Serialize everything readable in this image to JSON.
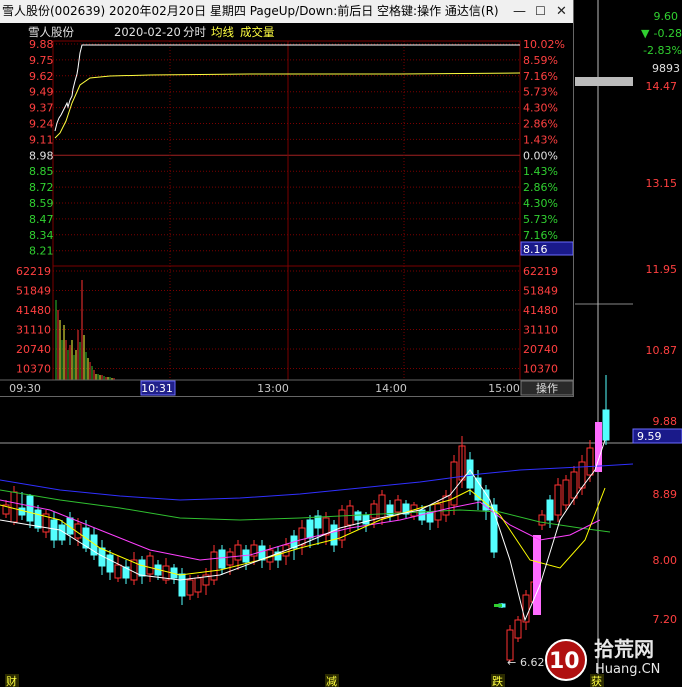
{
  "window": {
    "title": "雪人股份(002639) 2020年02月20日 星期四 PageUp/Down:前后日 空格键:操作 通达信(R)",
    "minimize_glyph": "—",
    "maximize_glyph": "☐",
    "close_glyph": "✕"
  },
  "intraday": {
    "stock_name": "雪人股份",
    "date": "2020-02-20",
    "mode": "分时",
    "avg_line_label": "均线",
    "volume_label": "成交量",
    "price_ticks": [
      "9.88",
      "9.75",
      "9.62",
      "9.49",
      "9.37",
      "9.24",
      "9.11",
      "8.98",
      "8.85",
      "8.72",
      "8.59",
      "8.47",
      "8.34",
      "8.21"
    ],
    "pct_ticks": [
      "10.02%",
      "8.59%",
      "7.16%",
      "5.73%",
      "4.30%",
      "2.86%",
      "1.43%",
      "0.00%",
      "1.43%",
      "2.86%",
      "4.30%",
      "5.73%",
      "7.16%"
    ],
    "current_price_tag": "8.16",
    "volume_ticks": [
      "62219",
      "51849",
      "41480",
      "31110",
      "20740",
      "10370"
    ],
    "time_ticks": [
      "09:30",
      "10:31",
      "13:00",
      "14:00",
      "15:00"
    ],
    "operate_label": "操作",
    "prev_close": 8.98
  },
  "right_panel": {
    "price": "9.60",
    "change": "-0.28",
    "change_pct": "-2.83%",
    "volume": "9893"
  },
  "kline": {
    "price_labels": [
      "14.47",
      "13.15",
      "11.95",
      "10.87",
      "9.88",
      "8.89",
      "8.00",
      "7.20"
    ],
    "current_price_tag": "9.59",
    "low_marker": "6.62",
    "bottom_labels": [
      "财",
      "减",
      "跌",
      "获"
    ],
    "watermark_logo_text": "10",
    "watermark_site": "拾荒网",
    "watermark_url": "Huang.CN"
  },
  "colors": {
    "up": "#ff3232",
    "down": "#54ffff",
    "gridred": "#7a0000",
    "label_red": "#ff4040",
    "label_green": "#30d030",
    "ma5": "#ffffff",
    "ma10": "#ffff00",
    "ma20": "#ff40ff",
    "ma30": "#30c030",
    "ma60": "#3030ff",
    "highlight": "#ff6cff"
  }
}
